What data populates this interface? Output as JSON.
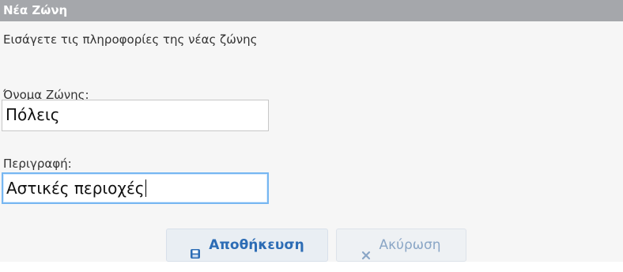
{
  "header": {
    "title": "Νέα Ζώνη"
  },
  "form": {
    "intro": "Εισάγετε τις πληροφορίες της νέας ζώνης",
    "zone_name_label": "Όνομα Ζώνης:",
    "zone_name_value": "Πόλεις",
    "description_label": "Περιγραφή:",
    "description_value": "Αστικές περιοχές"
  },
  "actions": {
    "save_label": "Αποθήκευση",
    "cancel_label": "Ακύρωση"
  },
  "icons": {
    "save": "save-icon",
    "cancel": "close-icon"
  },
  "colors": {
    "header_bg": "#a5a7ab",
    "primary": "#2c6cb5",
    "focus_border": "#76b6f1"
  }
}
